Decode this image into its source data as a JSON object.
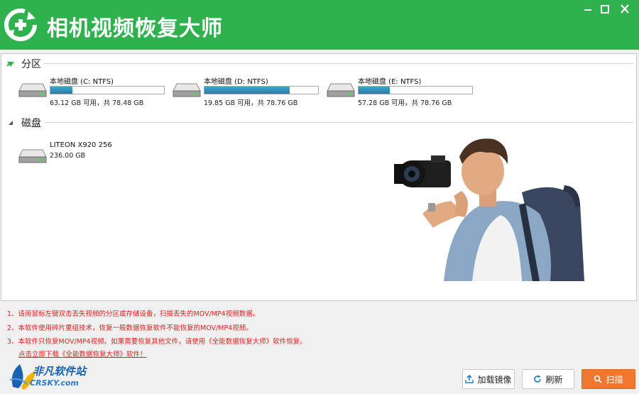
{
  "app": {
    "title": "相机视频恢复大师"
  },
  "sections": {
    "partitions_title": "分区",
    "disks_title": "磁盘"
  },
  "partitions": [
    {
      "name": "本地磁盘 (C: NTFS)",
      "size_text": "63.12 GB 可用，共 78.48 GB",
      "used_fraction": 0.196
    },
    {
      "name": "本地磁盘 (D: NTFS)",
      "size_text": "19.85 GB 可用，共 78.76 GB",
      "used_fraction": 0.748
    },
    {
      "name": "本地磁盘 (E: NTFS)",
      "size_text": "57.28 GB 可用，共 78.76 GB",
      "used_fraction": 0.273
    }
  ],
  "disks": [
    {
      "name": "LITEON X920 256",
      "size_text": "236.00 GB"
    }
  ],
  "tips": [
    "1、请用鼠标左键双击丢失视频的分区或存储设备，扫描丢失的MOV/MP4视频数据。",
    "2、本软件使用碎片重组技术，恢复一般数据恢复软件不能恢复的MOV/MP4视频。",
    "3、本软件只恢复MOV/MP4视频。如果需要恢复其他文件，请使用《全能数据恢复大师》软件恢复。"
  ],
  "download_link": "点击立即下载《全能数据恢复大师》软件！",
  "watermark": {
    "line1": "非凡软件站",
    "line2": "CRSKY.com"
  },
  "buttons": {
    "mount": "加载镜像",
    "refresh": "刷新",
    "scan": "扫描"
  },
  "colors": {
    "titlebar": "#2fb14e",
    "scan_button": "#f2772e",
    "tip_text": "#e02020",
    "bar_fill": "#1c7fa6"
  }
}
